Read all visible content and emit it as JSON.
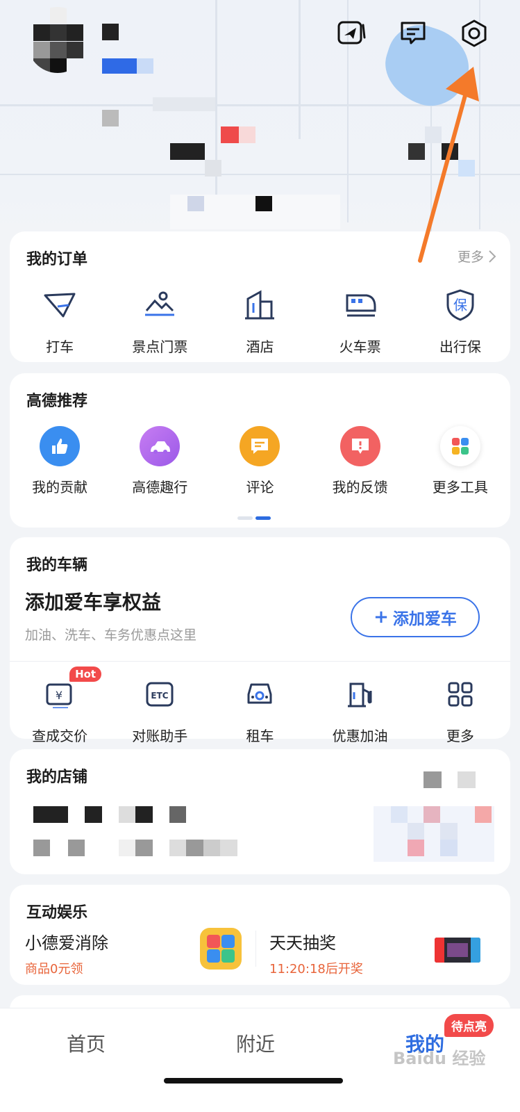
{
  "header": {
    "icons": [
      "share-icon",
      "message-icon",
      "settings-icon"
    ]
  },
  "orders": {
    "title": "我的订单",
    "more": "更多",
    "items": [
      {
        "label": "打车",
        "icon": "taxi-icon"
      },
      {
        "label": "景点门票",
        "icon": "scenic-ticket-icon"
      },
      {
        "label": "酒店",
        "icon": "hotel-icon"
      },
      {
        "label": "火车票",
        "icon": "train-icon"
      },
      {
        "label": "出行保",
        "icon": "insurance-icon"
      }
    ]
  },
  "recommend": {
    "title": "高德推荐",
    "items": [
      {
        "label": "我的贡献",
        "icon": "thumbs-up-icon",
        "color": "#3a8ef0"
      },
      {
        "label": "高德趣行",
        "icon": "car-trip-icon",
        "color": "#b06ef0"
      },
      {
        "label": "评论",
        "icon": "comment-icon",
        "color": "#f5a623"
      },
      {
        "label": "我的反馈",
        "icon": "feedback-icon",
        "color": "#f26262"
      },
      {
        "label": "更多工具",
        "icon": "more-tools-icon",
        "color": "#ffffff"
      }
    ]
  },
  "vehicle": {
    "title": "我的车辆",
    "headline": "添加爱车享权益",
    "subtitle": "加油、洗车、车务优惠点这里",
    "add_button": "添加爱车",
    "hot_badge": "Hot",
    "tools": [
      {
        "label": "查成交价",
        "icon": "price-check-icon"
      },
      {
        "label": "对账助手",
        "icon": "etc-icon"
      },
      {
        "label": "租车",
        "icon": "car-rental-icon"
      },
      {
        "label": "优惠加油",
        "icon": "fuel-icon"
      },
      {
        "label": "更多",
        "icon": "grid-more-icon"
      }
    ]
  },
  "store": {
    "title": "我的店铺"
  },
  "entertainment": {
    "title": "互动娱乐",
    "items": [
      {
        "title": "小德爱消除",
        "subtitle": "商品0元领"
      },
      {
        "title": "天天抽奖",
        "subtitle": "11:20:18后开奖"
      }
    ]
  },
  "nav": {
    "home": "首页",
    "nearby": "附近",
    "mine": "我的",
    "badge": "待点亮",
    "watermark": "Baidu 经验"
  },
  "colors": {
    "accent": "#2d6ce0",
    "arrow": "#f47a2a",
    "badge": "#f24a4a"
  }
}
